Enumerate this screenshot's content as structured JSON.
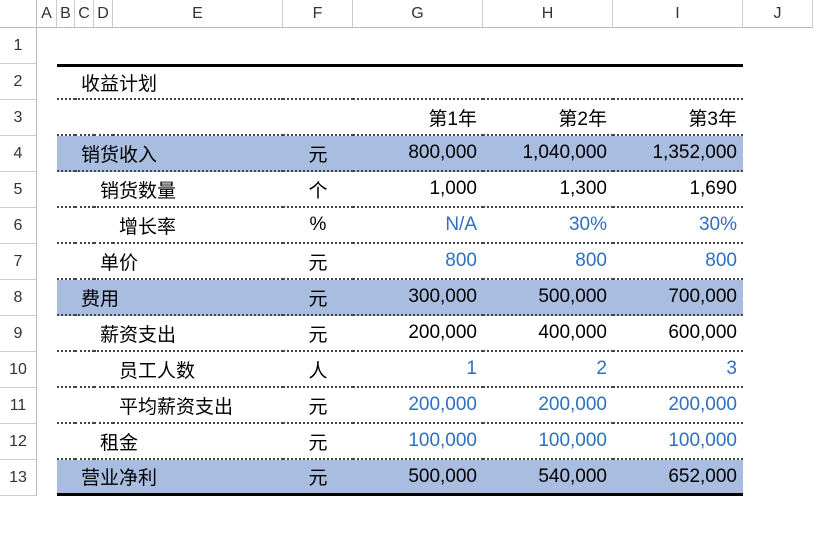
{
  "columns": [
    "A",
    "B",
    "C",
    "D",
    "E",
    "F",
    "G",
    "H",
    "I",
    "J"
  ],
  "row_count": 13,
  "title": "收益计划",
  "year_headers": [
    "第1年",
    "第2年",
    "第3年"
  ],
  "rows": {
    "sales_revenue": {
      "label": "销货收入",
      "unit": "元",
      "values": [
        "800,000",
        "1,040,000",
        "1,352,000"
      ]
    },
    "sales_qty": {
      "label": "销货数量",
      "unit": "个",
      "values": [
        "1,000",
        "1,300",
        "1,690"
      ]
    },
    "growth": {
      "label": "增长率",
      "unit": "%",
      "values": [
        "N/A",
        "30%",
        "30%"
      ]
    },
    "unit_price": {
      "label": "单价",
      "unit": "元",
      "values": [
        "800",
        "800",
        "800"
      ]
    },
    "expenses": {
      "label": "费用",
      "unit": "元",
      "values": [
        "300,000",
        "500,000",
        "700,000"
      ]
    },
    "salary": {
      "label": "薪资支出",
      "unit": "元",
      "values": [
        "200,000",
        "400,000",
        "600,000"
      ]
    },
    "headcount": {
      "label": "员工人数",
      "unit": "人",
      "values": [
        "1",
        "2",
        "3"
      ]
    },
    "avg_salary": {
      "label": "平均薪资支出",
      "unit": "元",
      "values": [
        "200,000",
        "200,000",
        "200,000"
      ]
    },
    "rent": {
      "label": "租金",
      "unit": "元",
      "values": [
        "100,000",
        "100,000",
        "100,000"
      ]
    },
    "net": {
      "label": "营业净利",
      "unit": "元",
      "values": [
        "500,000",
        "540,000",
        "652,000"
      ]
    }
  }
}
